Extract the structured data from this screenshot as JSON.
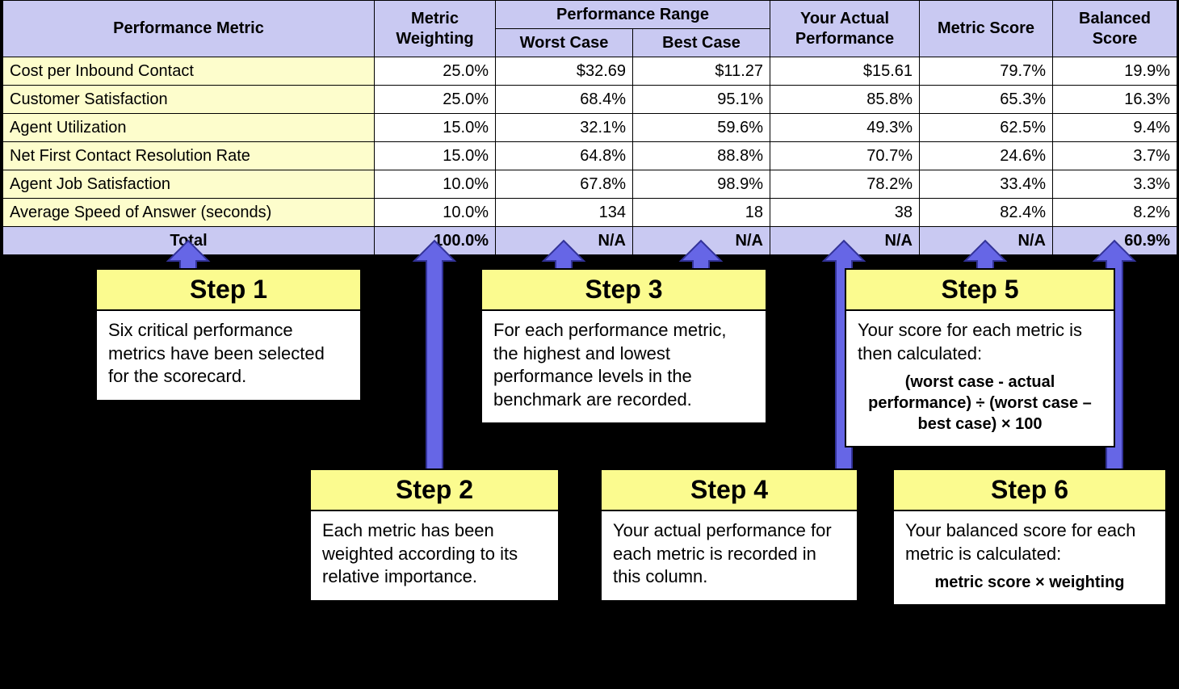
{
  "table": {
    "headers": {
      "metric": "Performance Metric",
      "weighting": "Metric Weighting",
      "perf_range": "Performance Range",
      "worst": "Worst Case",
      "best": "Best Case",
      "actual": "Your Actual Performance",
      "score": "Metric Score",
      "balanced": "Balanced Score"
    },
    "rows": [
      {
        "metric": "Cost per Inbound Contact",
        "weight": "25.0%",
        "worst": "$32.69",
        "best": "$11.27",
        "actual": "$15.61",
        "score": "79.7%",
        "balanced": "19.9%"
      },
      {
        "metric": "Customer Satisfaction",
        "weight": "25.0%",
        "worst": "68.4%",
        "best": "95.1%",
        "actual": "85.8%",
        "score": "65.3%",
        "balanced": "16.3%"
      },
      {
        "metric": "Agent Utilization",
        "weight": "15.0%",
        "worst": "32.1%",
        "best": "59.6%",
        "actual": "49.3%",
        "score": "62.5%",
        "balanced": "9.4%"
      },
      {
        "metric": "Net First Contact Resolution Rate",
        "weight": "15.0%",
        "worst": "64.8%",
        "best": "88.8%",
        "actual": "70.7%",
        "score": "24.6%",
        "balanced": "3.7%"
      },
      {
        "metric": "Agent Job Satisfaction",
        "weight": "10.0%",
        "worst": "67.8%",
        "best": "98.9%",
        "actual": "78.2%",
        "score": "33.4%",
        "balanced": "3.3%"
      },
      {
        "metric": "Average Speed of Answer (seconds)",
        "weight": "10.0%",
        "worst": "134",
        "best": "18",
        "actual": "38",
        "score": "82.4%",
        "balanced": "8.2%"
      }
    ],
    "total": {
      "label": "Total",
      "weight": "100.0%",
      "worst": "N/A",
      "best": "N/A",
      "actual": "N/A",
      "score": "N/A",
      "balanced": "60.9%"
    }
  },
  "callouts": {
    "step1": {
      "title": "Step 1",
      "body": "Six critical performance metrics have been selected for the scorecard."
    },
    "step2": {
      "title": "Step 2",
      "body": "Each metric has been weighted according to its relative importance."
    },
    "step3": {
      "title": "Step 3",
      "body": "For each performance metric, the highest and lowest performance levels in the benchmark are recorded."
    },
    "step4": {
      "title": "Step 4",
      "body": "Your actual performance for each metric is recorded in this column."
    },
    "step5": {
      "title": "Step 5",
      "body": "Your score for each metric is then calculated:",
      "formula": "(worst case - actual performance) ÷ (worst case – best case) × 100"
    },
    "step6": {
      "title": "Step 6",
      "body": "Your balanced score for each metric is calculated:",
      "formula": "metric score × weighting"
    }
  }
}
